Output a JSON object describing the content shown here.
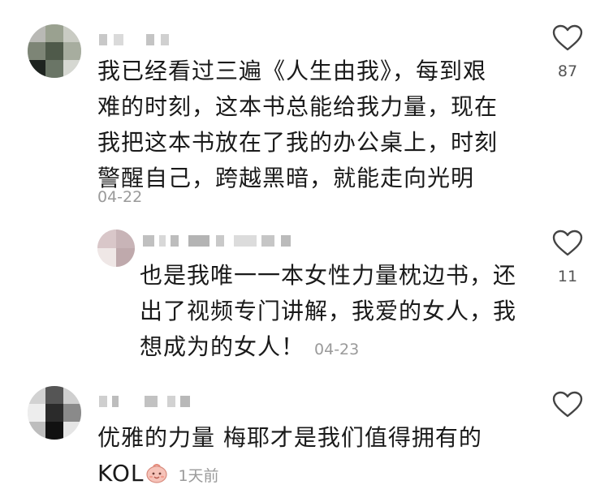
{
  "comments": [
    {
      "text": "我已经看过三遍《人生由我》，每到艰\n难的时刻，这本书总能给我力量，现在\n我把这本书放在了我的办公桌上，时刻\n警醒自己，跨越黑暗，就能走向光明",
      "date": "04-22",
      "likes": "87"
    },
    {
      "text": "也是我唯一一本女性力量枕边书，还\n出了视频专门讲解，我爱的女人，我\n想成为的女人！",
      "date": "04-23",
      "likes": "11"
    },
    {
      "text": "优雅的力量 梅耶才是我们值得拥有的\nKOL",
      "date": "1天前",
      "emoji": "smiling-face-emoji"
    }
  ],
  "icons": {
    "like": "heart-outline-icon"
  },
  "colors": {
    "text": "#1a1a1a",
    "meta": "#9a9a9a",
    "like_count": "#555555"
  }
}
